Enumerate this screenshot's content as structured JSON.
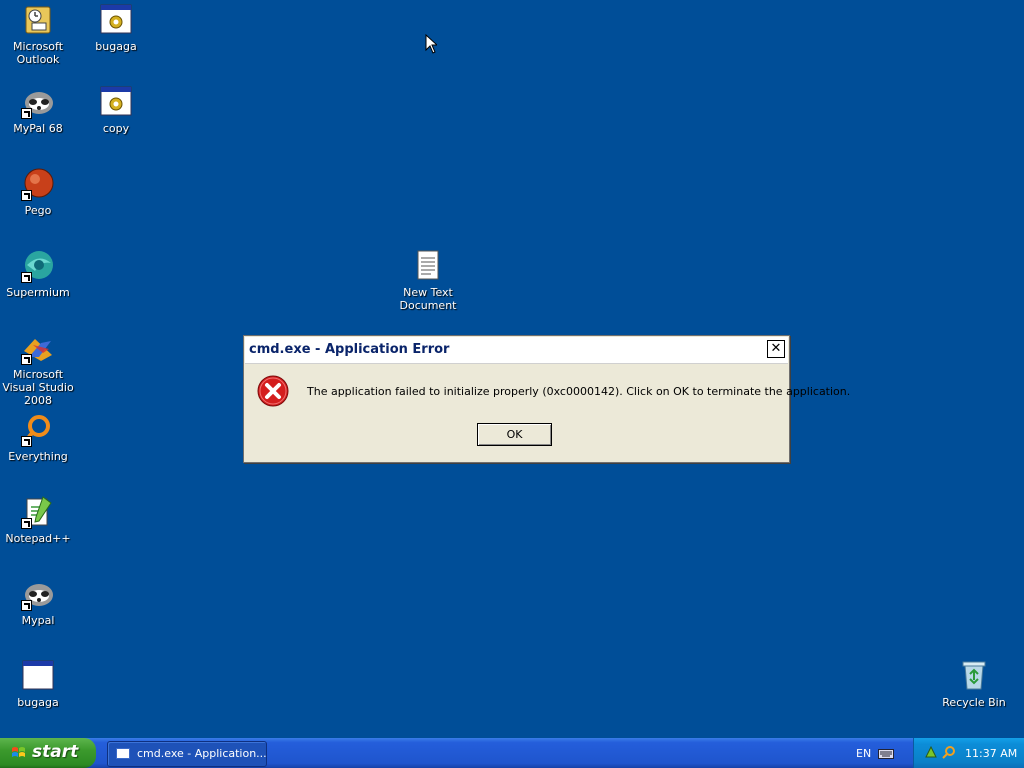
{
  "desktop": {
    "icons": [
      {
        "label": "Microsoft Outlook",
        "icon": "outlook-icon"
      },
      {
        "label": "bugaga",
        "icon": "batch-file-icon"
      },
      {
        "label": "MyPal 68",
        "icon": "mypal-icon"
      },
      {
        "label": "copy",
        "icon": "batch-file-icon"
      },
      {
        "label": "Pego",
        "icon": "pego-icon"
      },
      {
        "label": "Supermium",
        "icon": "supermium-icon"
      },
      {
        "label": "New Text Document",
        "icon": "text-document-icon"
      },
      {
        "label": "Microsoft Visual Studio 2008",
        "icon": "visual-studio-icon"
      },
      {
        "label": "Everything",
        "icon": "everything-search-icon"
      },
      {
        "label": "Notepad++",
        "icon": "notepadpp-icon"
      },
      {
        "label": "Mypal",
        "icon": "mypal-icon"
      },
      {
        "label": "bugaga",
        "icon": "window-icon"
      },
      {
        "label": "Recycle Bin",
        "icon": "recycle-bin-icon"
      }
    ]
  },
  "dialog": {
    "title": "cmd.exe - Application Error",
    "message": "The application failed to initialize properly (0xc0000142). Click on OK to terminate the application.",
    "ok_label": "OK",
    "close_label": "✕"
  },
  "taskbar": {
    "start_label": "start",
    "task_button_label": "cmd.exe - Application...",
    "language": "EN",
    "clock": "11:37 AM"
  },
  "colors": {
    "desktop_bg": "#004e98",
    "taskbar_blue": "#245edb",
    "start_green": "#3c9a2d",
    "tray_blue": "#0c8dd8",
    "dialog_bg": "#ece9d8"
  }
}
